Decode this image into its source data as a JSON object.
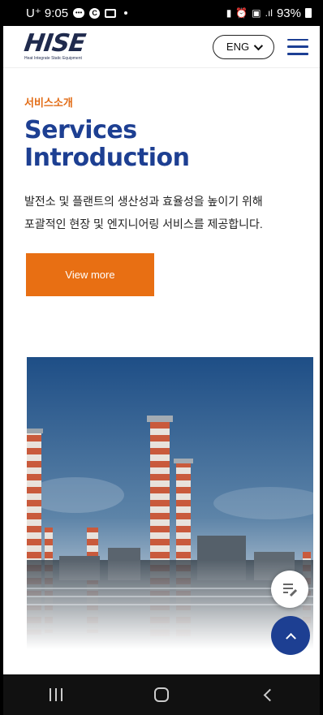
{
  "status_bar": {
    "carrier_time": "U⁺ 9:05",
    "signal_text": ".ıl",
    "battery_text": "93%"
  },
  "header": {
    "logo_text": "HISE",
    "logo_subtitle": "Heat Integrate Static Equipment",
    "lang_label": "ENG"
  },
  "main": {
    "eyebrow": "서비스소개",
    "headline": "Services Introduction",
    "description_line1": "발전소 및 플랜트의 생산성과 효율성을 높이기 위해",
    "description_line2": "포괄적인 현장 및 엔지니어링 서비스를 제공합니다.",
    "cta_label": "View more"
  },
  "colors": {
    "brand_blue": "#1d3f92",
    "accent_orange": "#e86f13"
  },
  "icons": {
    "menu": "hamburger-icon",
    "lang_dropdown": "chevron-down-icon",
    "edit_fab": "edit-note-icon",
    "scroll_top": "chevron-up-icon"
  }
}
